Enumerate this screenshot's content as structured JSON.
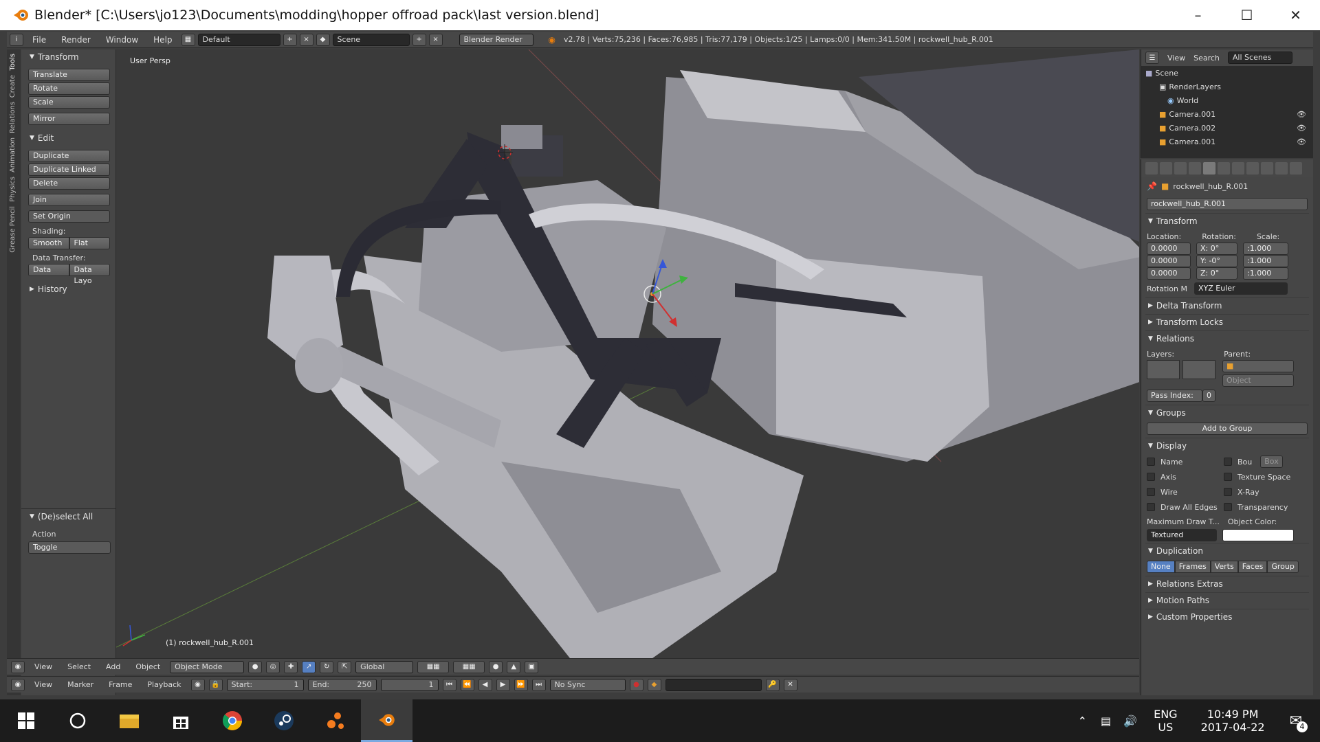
{
  "window": {
    "title": "Blender* [C:\\Users\\jo123\\Documents\\modding\\hopper offroad pack\\last version.blend]"
  },
  "infobar": {
    "menus": [
      "File",
      "Render",
      "Window",
      "Help"
    ],
    "screen": "Default",
    "scene": "Scene",
    "engine": "Blender Render",
    "stats": "v2.78 | Verts:75,236 | Faces:76,985 | Tris:77,179 | Objects:1/25 | Lamps:0/0 | Mem:341.50M | rockwell_hub_R.001"
  },
  "left_tabs": [
    "Tools",
    "Create",
    "Relations",
    "Animation",
    "Physics",
    "Grease Pencil"
  ],
  "toolshelf": {
    "transform_header": "Transform",
    "transform_buttons": [
      "Translate",
      "Rotate",
      "Scale"
    ],
    "mirror": "Mirror",
    "edit_header": "Edit",
    "edit_buttons": [
      "Duplicate",
      "Duplicate Linked",
      "Delete"
    ],
    "join": "Join",
    "set_origin": "Set Origin",
    "shading_label": "Shading:",
    "smooth": "Smooth",
    "flat": "Flat",
    "data_transfer_label": "Data Transfer:",
    "data": "Data",
    "data_layout": "Data Layo",
    "history": "History",
    "operator_header": "(De)select All",
    "action_label": "Action",
    "action_value": "Toggle"
  },
  "viewport": {
    "view_label": "User Persp",
    "object_label": "(1) rockwell_hub_R.001"
  },
  "outliner": {
    "menus": [
      "View",
      "Search"
    ],
    "filter": "All Scenes",
    "items": [
      "Scene",
      "RenderLayers",
      "World",
      "Camera.001",
      "Camera.002",
      "Camera.001"
    ]
  },
  "properties": {
    "object_path": "rockwell_hub_R.001",
    "object_name": "rockwell_hub_R.001",
    "transform": "Transform",
    "location_label": "Location:",
    "rotation_label": "Rotation:",
    "scale_label": "Scale:",
    "location": [
      "0.0000",
      "0.0000",
      "0.0000"
    ],
    "rotation": [
      "X:  0°",
      "Y: -0°",
      "Z:  0°"
    ],
    "scale": [
      ":1.000",
      ":1.000",
      ":1.000"
    ],
    "rotation_mode_label": "Rotation M",
    "rotation_mode": "XYZ Euler",
    "delta_transform": "Delta Transform",
    "transform_locks": "Transform Locks",
    "relations": "Relations",
    "layers_label": "Layers:",
    "parent_label": "Parent:",
    "parent_type": "Object",
    "pass_index": "Pass Index:",
    "pass_index_value": "0",
    "groups": "Groups",
    "add_to_group": "Add to Group",
    "display": "Display",
    "display_left": [
      "Name",
      "Axis",
      "Wire",
      "Draw All Edges"
    ],
    "display_right": [
      "Bou",
      "Texture Space",
      "X-Ray",
      "Transparency"
    ],
    "bounds_type": "Box",
    "max_draw_label": "Maximum Draw T...",
    "object_color_label": "Object Color:",
    "max_draw_value": "Textured",
    "duplication": "Duplication",
    "dup_tabs": [
      "None",
      "Frames",
      "Verts",
      "Faces",
      "Group"
    ],
    "relations_extras": "Relations Extras",
    "motion_paths": "Motion Paths",
    "custom_properties": "Custom Properties"
  },
  "view3d_header": {
    "menus": [
      "View",
      "Select",
      "Add",
      "Object"
    ],
    "mode": "Object Mode",
    "orientation": "Global"
  },
  "timeline": {
    "menus": [
      "View",
      "Marker",
      "Frame",
      "Playback"
    ],
    "start_label": "Start:",
    "start": "1",
    "end_label": "End:",
    "end": "250",
    "current": "1",
    "sync": "No Sync"
  },
  "taskbar": {
    "lang_top": "ENG",
    "lang_bottom": "US",
    "time": "10:49 PM",
    "date": "2017-04-22",
    "notifications": "4"
  },
  "colors": {
    "accent": "#5680c2",
    "blender_orange": "#e87d0d"
  }
}
